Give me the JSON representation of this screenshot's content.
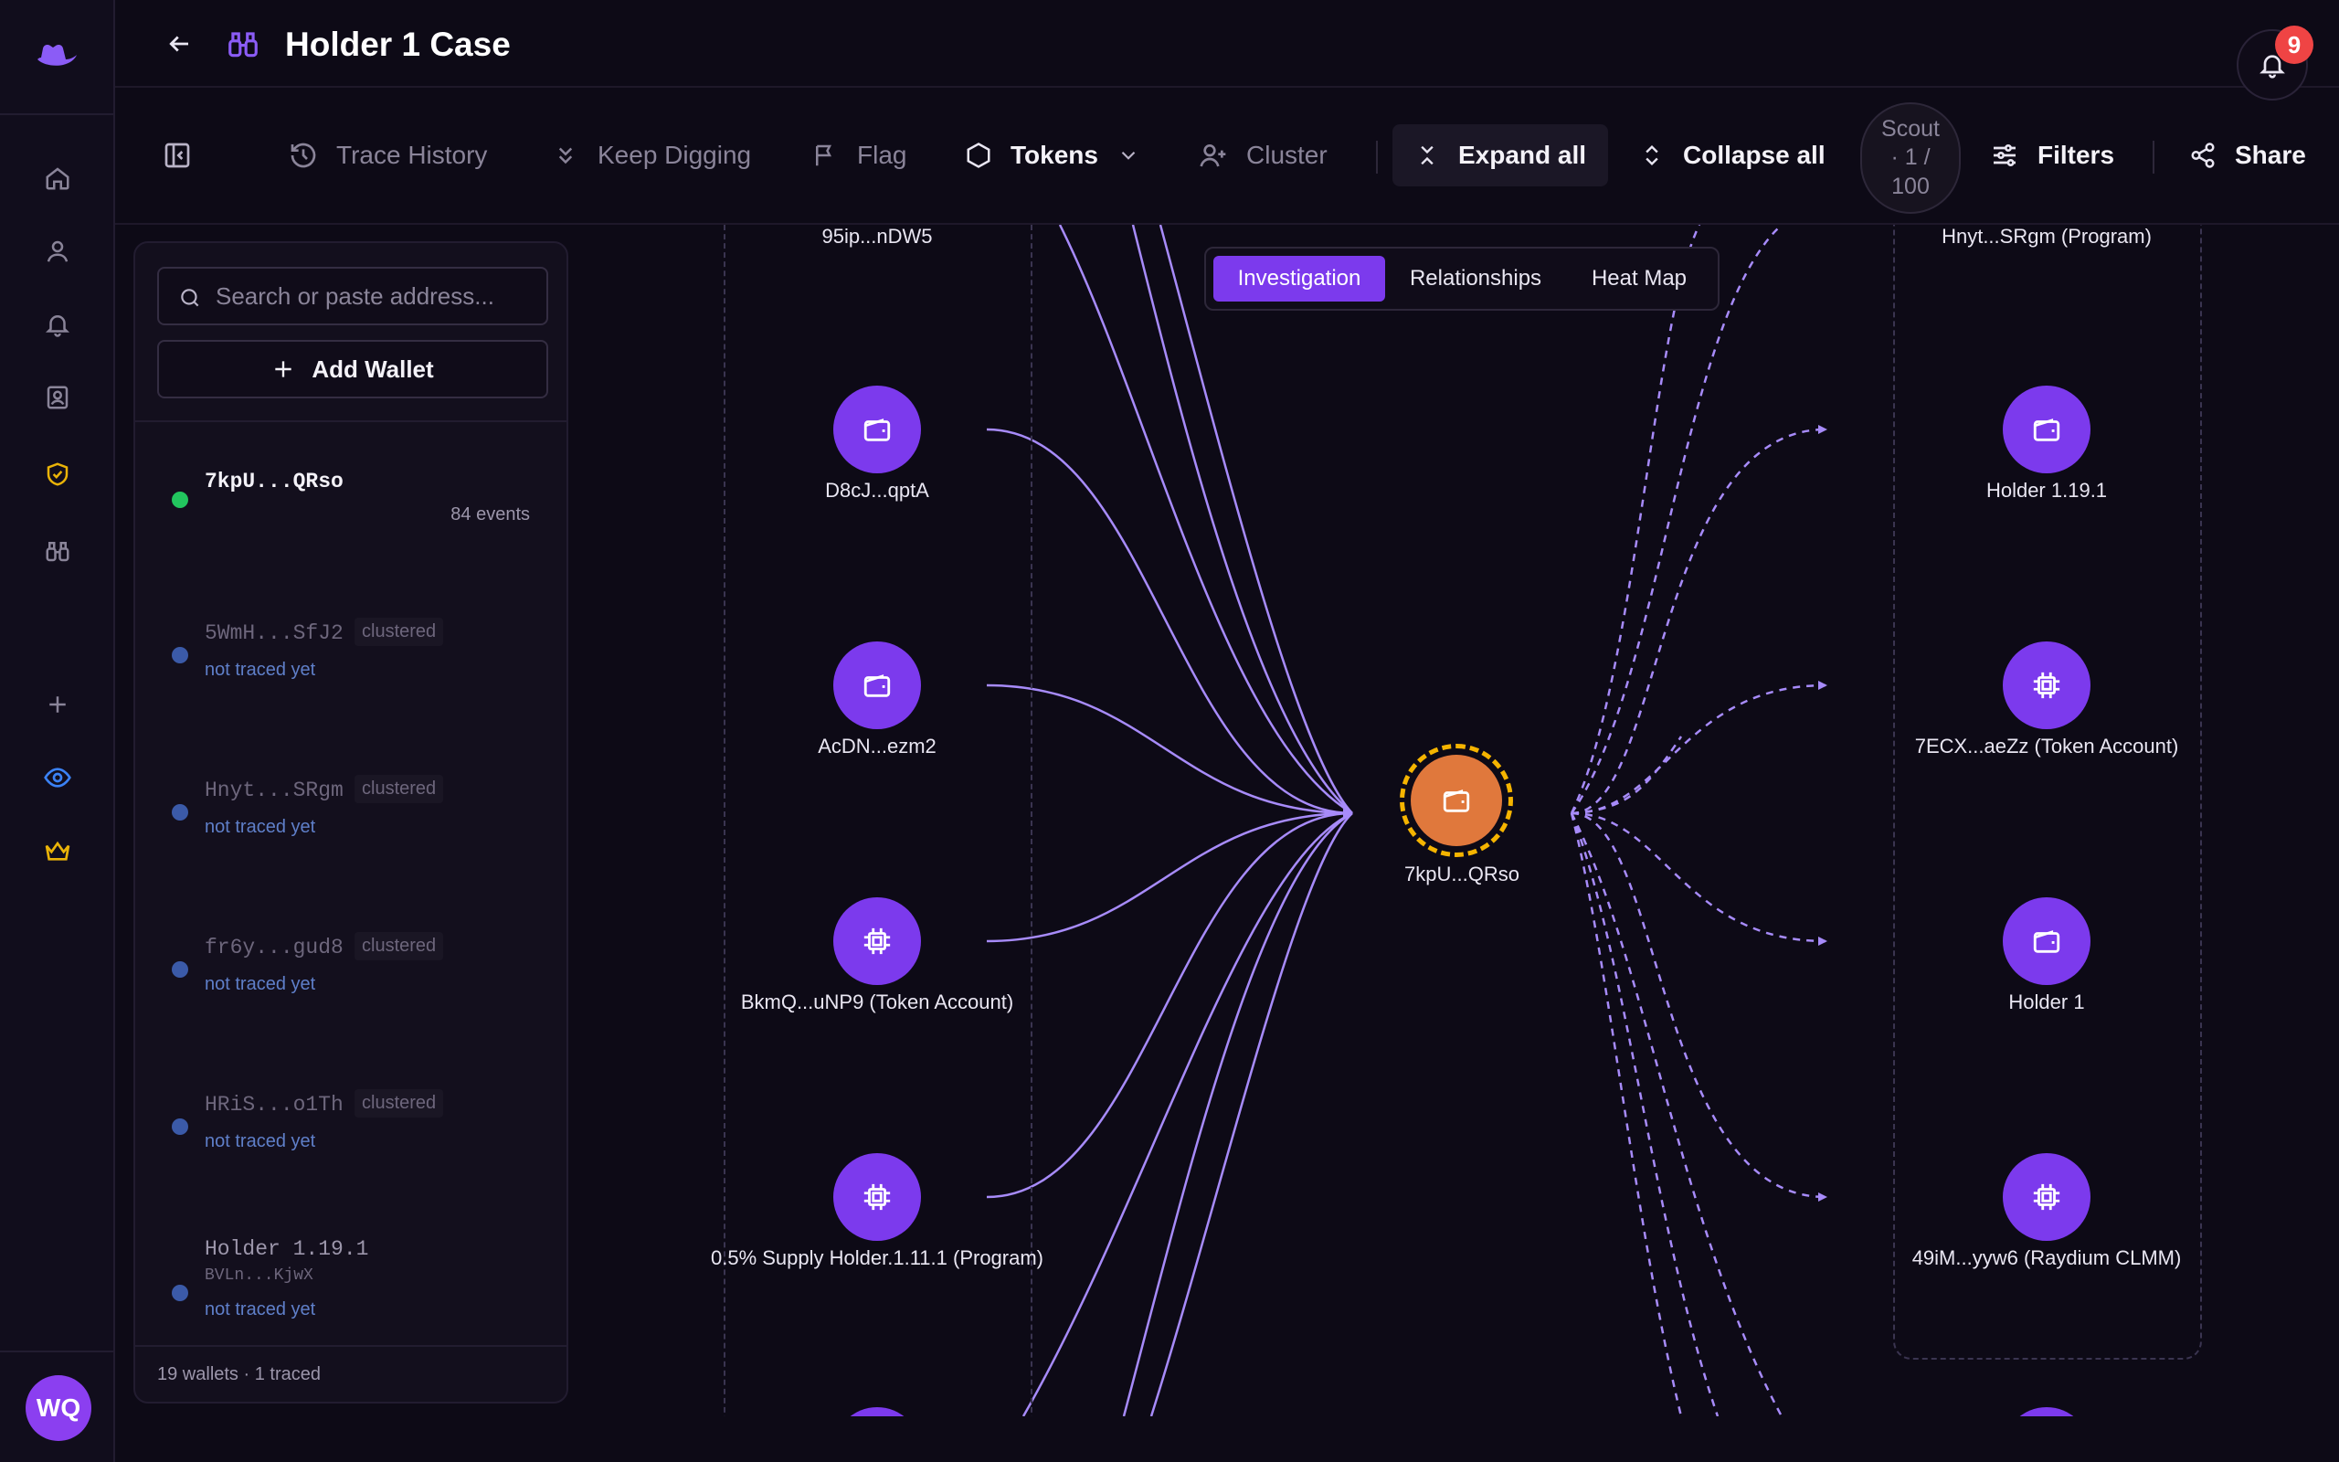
{
  "header": {
    "title": "Holder 1 Case",
    "notifications_count": "9"
  },
  "toolbar": {
    "trace_history": "Trace History",
    "keep_digging": "Keep Digging",
    "flag": "Flag",
    "tokens": "Tokens",
    "cluster": "Cluster",
    "expand_all": "Expand all",
    "collapse_all": "Collapse all",
    "scout_line1": "Scout",
    "scout_line2": "· 1 /",
    "scout_line3": "100",
    "filters": "Filters",
    "share": "Share"
  },
  "panel": {
    "search_placeholder": "Search or paste address...",
    "add_wallet": "Add Wallet",
    "wallets": [
      {
        "name": "7kpU...QRso",
        "events": "84 events",
        "status": "active"
      },
      {
        "name": "5WmH...SfJ2",
        "tag": "clustered",
        "sub": "not traced yet"
      },
      {
        "name": "Hnyt...SRgm",
        "tag": "clustered",
        "sub": "not traced yet"
      },
      {
        "name": "fr6y...gud8",
        "tag": "clustered",
        "sub": "not traced yet"
      },
      {
        "name": "HRiS...o1Th",
        "tag": "clustered",
        "sub": "not traced yet"
      },
      {
        "name": "Holder 1.19.1",
        "addr": "BVLn...KjwX",
        "sub": "not traced yet"
      }
    ],
    "footer": "19 wallets · 1 traced"
  },
  "view_tabs": [
    "Investigation",
    "Relationships",
    "Heat Map"
  ],
  "graph": {
    "center": {
      "label": "7kpU...QRso",
      "icon": "wallet-icon"
    },
    "left_top_label": "95ip...nDW5",
    "right_top_label": "Hnyt...SRgm (Program)",
    "left_nodes": [
      {
        "label": "D8cJ...qptA",
        "icon": "wallet-icon"
      },
      {
        "label": "AcDN...ezm2",
        "icon": "wallet-icon"
      },
      {
        "label": "BkmQ...uNP9 (Token Account)",
        "icon": "chip-icon"
      },
      {
        "label": "0.5% Supply Holder.1.11.1 (Program)",
        "icon": "chip-icon"
      }
    ],
    "right_nodes": [
      {
        "label": "Holder 1.19.1",
        "icon": "wallet-icon"
      },
      {
        "label": "7ECX...aeZz (Token Account)",
        "icon": "chip-icon"
      },
      {
        "label": "Holder 1",
        "icon": "wallet-icon"
      },
      {
        "label": "49iM...yyw6 (Raydium CLMM)",
        "icon": "chip-icon"
      }
    ]
  },
  "user": {
    "initials": "WQ"
  },
  "colors": {
    "accent": "#7c3aed",
    "center_node": "#e0783c",
    "ring": "#f5b400",
    "edge": "#a78bfa",
    "active_dot": "#22c55e"
  }
}
